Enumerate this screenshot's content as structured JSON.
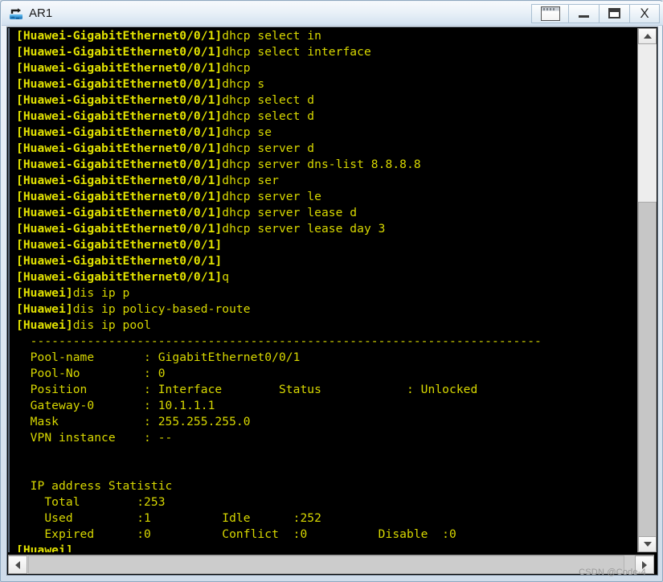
{
  "window": {
    "title": "AR1",
    "icon": "router-icon",
    "controls": [
      {
        "name": "restore-window-group-button",
        "icon": "window-stack-icon",
        "label": ""
      },
      {
        "name": "minimize-button",
        "icon": "minimize-icon",
        "label": "—"
      },
      {
        "name": "maximize-button",
        "icon": "maximize-icon",
        "label": ""
      },
      {
        "name": "close-button",
        "icon": "close-icon",
        "label": "X"
      }
    ]
  },
  "terminal": {
    "foreground_color": "#d8d800",
    "background_color": "#000000",
    "lines": [
      "[Huawei-GigabitEthernet0/0/1]dhcp select in",
      "[Huawei-GigabitEthernet0/0/1]dhcp select interface",
      "[Huawei-GigabitEthernet0/0/1]dhcp",
      "[Huawei-GigabitEthernet0/0/1]dhcp s",
      "[Huawei-GigabitEthernet0/0/1]dhcp select d",
      "[Huawei-GigabitEthernet0/0/1]dhcp select d",
      "[Huawei-GigabitEthernet0/0/1]dhcp se",
      "[Huawei-GigabitEthernet0/0/1]dhcp server d",
      "[Huawei-GigabitEthernet0/0/1]dhcp server dns-list 8.8.8.8",
      "[Huawei-GigabitEthernet0/0/1]dhcp ser",
      "[Huawei-GigabitEthernet0/0/1]dhcp server le",
      "[Huawei-GigabitEthernet0/0/1]dhcp server lease d",
      "[Huawei-GigabitEthernet0/0/1]dhcp server lease day 3",
      "[Huawei-GigabitEthernet0/0/1]",
      "[Huawei-GigabitEthernet0/0/1]",
      "[Huawei-GigabitEthernet0/0/1]q",
      "[Huawei]dis ip p",
      "[Huawei]dis ip policy-based-route",
      "[Huawei]dis ip pool",
      "  ------------------------------------------------------------------------",
      "  Pool-name       : GigabitEthernet0/0/1",
      "  Pool-No         : 0",
      "  Position        : Interface        Status            : Unlocked",
      "  Gateway-0       : 10.1.1.1",
      "  Mask            : 255.255.255.0",
      "  VPN instance    : --",
      "",
      "",
      "  IP address Statistic",
      "    Total        :253",
      "    Used         :1          Idle      :252",
      "    Expired      :0          Conflict  :0          Disable  :0",
      "[Huawei]"
    ]
  },
  "scrollbars": {
    "vertical": {
      "up_icon": "chevron-up-icon",
      "down_icon": "chevron-down-icon"
    },
    "horizontal": {
      "left_icon": "chevron-left-icon",
      "right_icon": "chevron-right-icon"
    }
  },
  "watermark": {
    "text": "CSDN @Code-4"
  }
}
